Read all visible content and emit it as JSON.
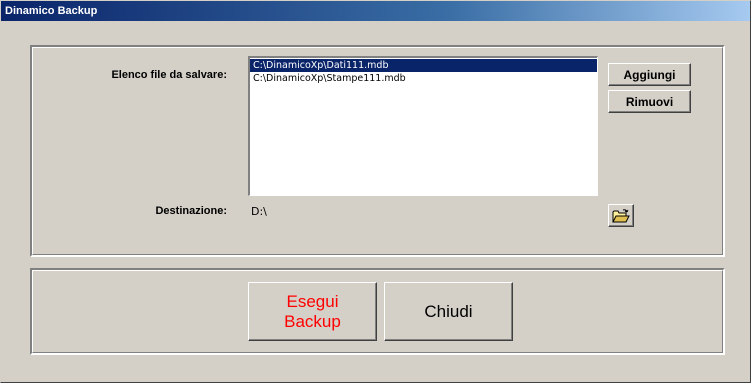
{
  "window": {
    "title": "Dinamico Backup"
  },
  "files": {
    "label": "Elenco file da salvare:",
    "items": [
      {
        "path": "C:\\DinamicoXp\\Dati111.mdb",
        "selected": true
      },
      {
        "path": "C:\\DinamicoXp\\Stampe111.mdb",
        "selected": false
      }
    ],
    "add_label": "Aggiungi",
    "remove_label": "Rimuovi"
  },
  "destination": {
    "label": "Destinazione:",
    "value": "D:\\",
    "browse_icon": "open-folder-icon"
  },
  "actions": {
    "run_label_line1": "Esegui",
    "run_label_line2": "Backup",
    "run_color": "#ff0000",
    "close_label": "Chiudi"
  }
}
